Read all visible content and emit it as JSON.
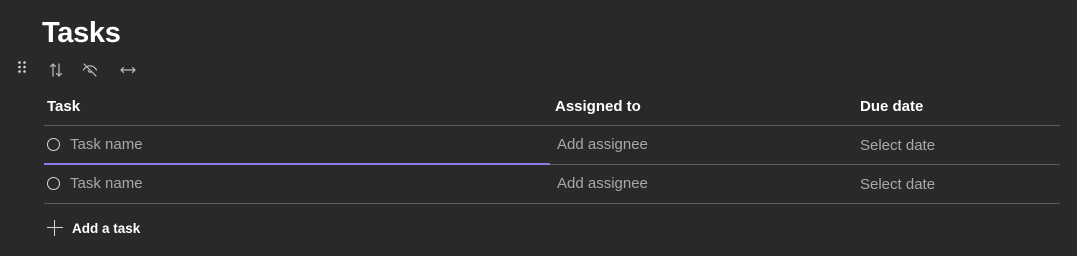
{
  "page": {
    "title": "Tasks"
  },
  "toolbar": {
    "icons": [
      "sort-icon",
      "hide-icon",
      "expand-width-icon"
    ]
  },
  "table": {
    "columns": [
      {
        "label": "Task"
      },
      {
        "label": "Assigned to"
      },
      {
        "label": "Due date"
      }
    ],
    "rows": [
      {
        "task_placeholder": "Task name",
        "assignee_placeholder": "Add assignee",
        "date_placeholder": "Select date",
        "focused": true
      },
      {
        "task_placeholder": "Task name",
        "assignee_placeholder": "Add assignee",
        "date_placeholder": "Select date",
        "focused": false
      }
    ]
  },
  "add_task": {
    "label": "Add a task"
  },
  "colors": {
    "background": "#292929",
    "accent": "#8d7ae8",
    "divider": "#5c5c5c",
    "placeholder": "#a8a8a8"
  }
}
